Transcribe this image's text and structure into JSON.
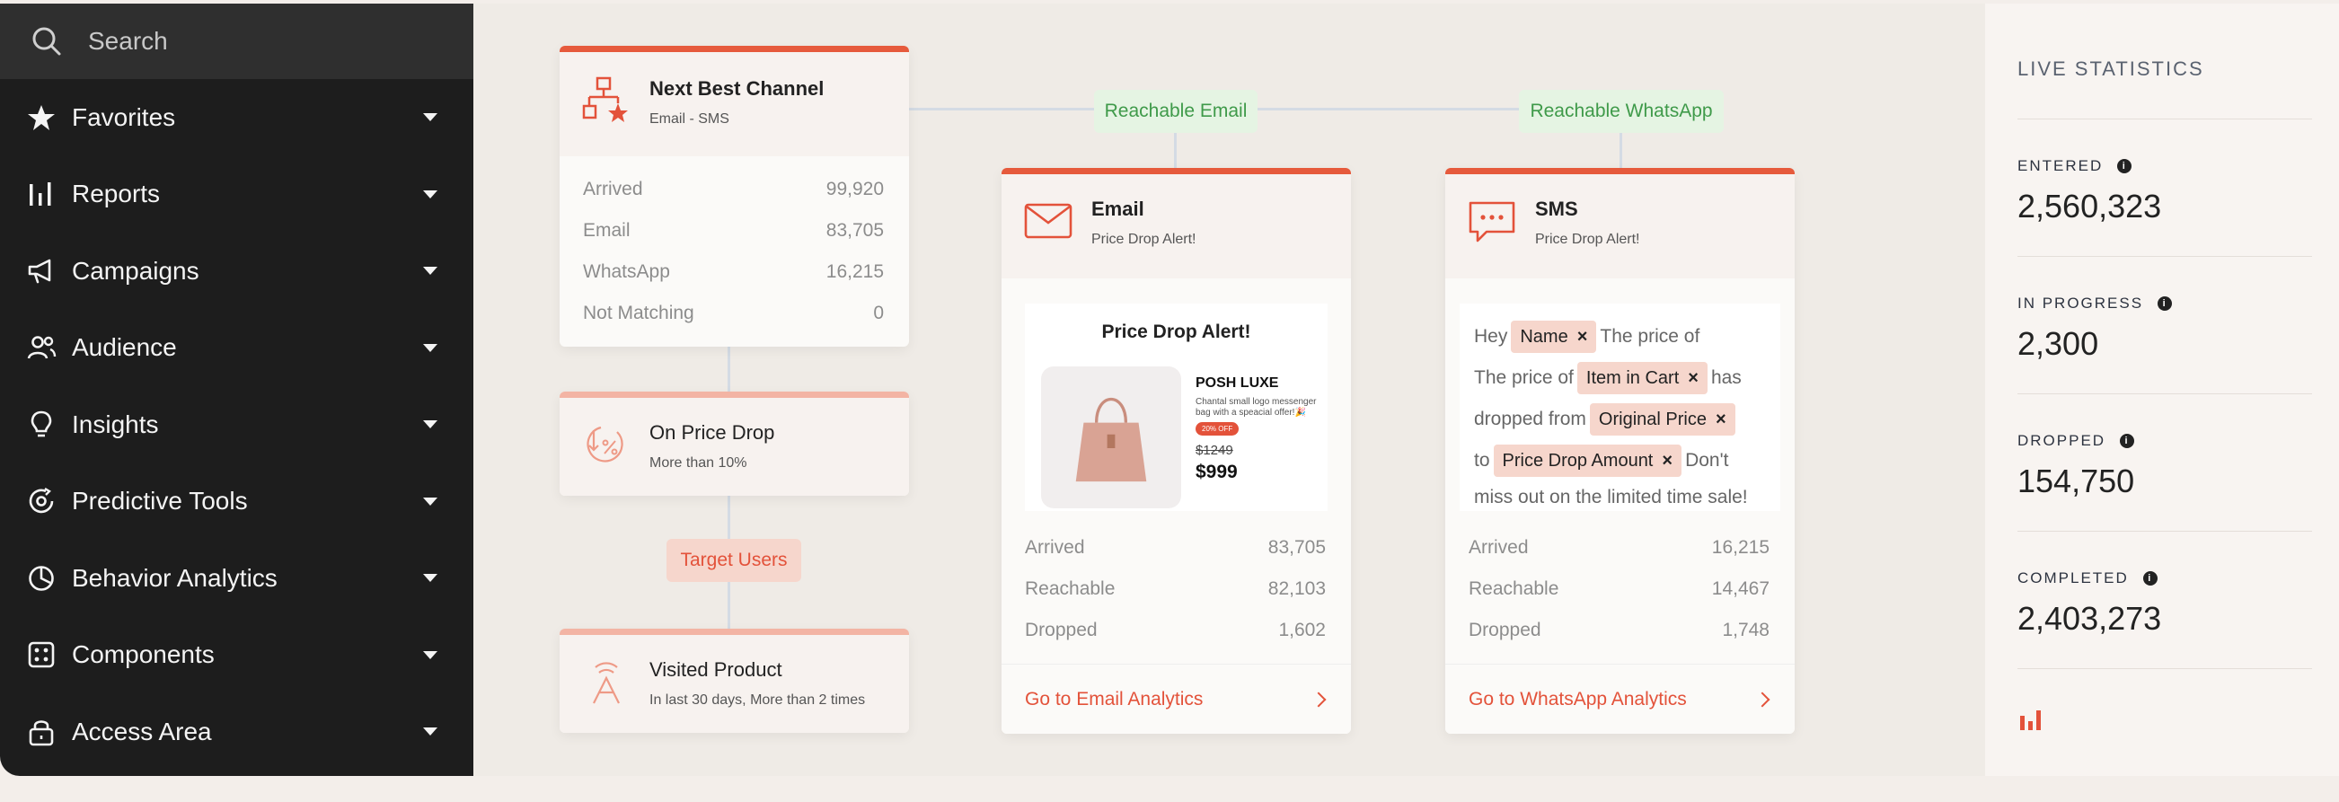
{
  "search": {
    "placeholder": "Search"
  },
  "sidebar": {
    "items": [
      {
        "label": "Favorites",
        "icon": "star-icon"
      },
      {
        "label": "Reports",
        "icon": "bar-chart-icon"
      },
      {
        "label": "Campaigns",
        "icon": "megaphone-icon"
      },
      {
        "label": "Audience",
        "icon": "users-icon"
      },
      {
        "label": "Insights",
        "icon": "lightbulb-icon"
      },
      {
        "label": "Predictive Tools",
        "icon": "predictive-icon"
      },
      {
        "label": "Behavior Analytics",
        "icon": "pie-clock-icon"
      },
      {
        "label": "Components",
        "icon": "grid-icon"
      },
      {
        "label": "Access Area",
        "icon": "lock-icon"
      }
    ]
  },
  "flow": {
    "next_best_channel": {
      "title": "Next Best Channel",
      "subtitle": "Email - SMS",
      "rows": [
        {
          "label": "Arrived",
          "value": "99,920"
        },
        {
          "label": "Email",
          "value": "83,705"
        },
        {
          "label": "WhatsApp",
          "value": "16,215"
        },
        {
          "label": "Not Matching",
          "value": "0"
        }
      ]
    },
    "on_price_drop": {
      "title": "On Price Drop",
      "subtitle": "More than 10%"
    },
    "target_users": "Target Users",
    "visited_product": {
      "title": "Visited Product",
      "subtitle": "In last 30 days, More than 2 times"
    },
    "reachable_email": "Reachable Email",
    "reachable_whatsapp": "Reachable WhatsApp",
    "email_card": {
      "title": "Email",
      "subtitle": "Price Drop Alert!",
      "preview": {
        "heading": "Price Drop Alert!",
        "brand": "POSH LUXE",
        "desc": "Chantal small logo messenger bag with a speacial offer!🎉",
        "badge": "20% OFF",
        "old_price": "$1249",
        "new_price": "$999"
      },
      "rows": [
        {
          "label": "Arrived",
          "value": "83,705"
        },
        {
          "label": "Reachable",
          "value": "82,103"
        },
        {
          "label": "Dropped",
          "value": "1,602"
        }
      ],
      "link": "Go to Email Analytics"
    },
    "sms_card": {
      "title": "SMS",
      "subtitle": "Price Drop Alert!",
      "message": {
        "w1": "Hey",
        "tag1": "Name",
        "w2": "The price of",
        "w3": "The price of",
        "tag2": "Item in Cart",
        "w4": "has",
        "w5": "dropped from",
        "tag3": "Original Price",
        "w6": "to",
        "tag4": "Price Drop Amount",
        "w7": "Don't",
        "w8": "miss out on the limited time sale!"
      },
      "rows": [
        {
          "label": "Arrived",
          "value": "16,215"
        },
        {
          "label": "Reachable",
          "value": "14,467"
        },
        {
          "label": "Dropped",
          "value": "1,748"
        }
      ],
      "link": "Go to WhatsApp Analytics"
    }
  },
  "stats": {
    "title": "LIVE STATISTICS",
    "items": [
      {
        "label": "ENTERED",
        "value": "2,560,323"
      },
      {
        "label": "IN PROGRESS",
        "value": "2,300"
      },
      {
        "label": "DROPPED",
        "value": "154,750"
      },
      {
        "label": "COMPLETED",
        "value": "2,403,273"
      }
    ],
    "footer_icon": "bar-chart-icon"
  },
  "colors": {
    "accent": "#e65a3c",
    "sidebar_bg": "#1d1d1d",
    "green_pill": "#3f9a4a"
  }
}
